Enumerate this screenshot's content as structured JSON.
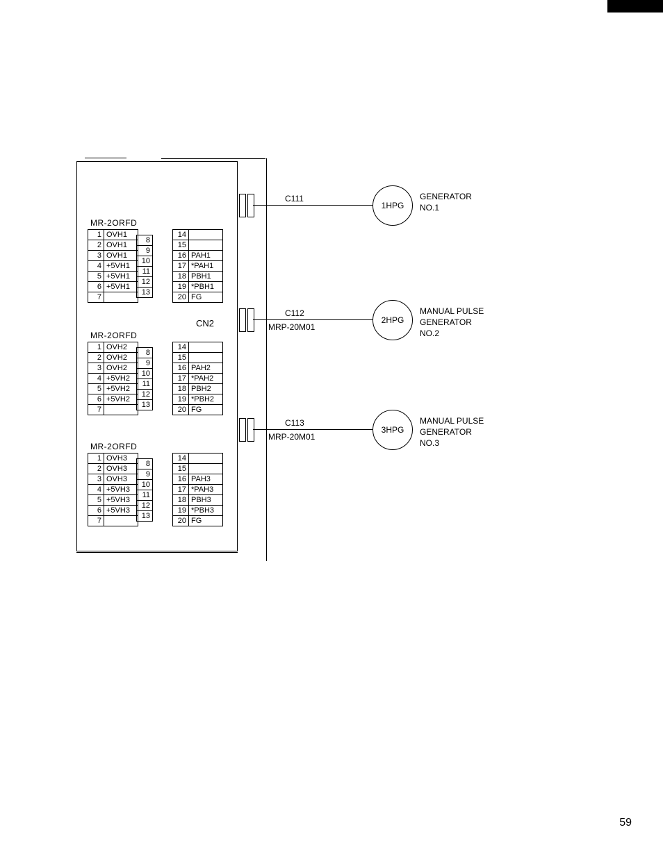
{
  "page_number": "59",
  "main_box_label": "CN2",
  "connectors": [
    {
      "title": "MR-2ORFD",
      "colA": [
        {
          "n": "1",
          "s": "OVH1"
        },
        {
          "n": "2",
          "s": "OVH1"
        },
        {
          "n": "3",
          "s": "OVH1"
        },
        {
          "n": "4",
          "s": "+5VH1"
        },
        {
          "n": "5",
          "s": "+5VH1"
        },
        {
          "n": "6",
          "s": "+5VH1"
        },
        {
          "n": "7",
          "s": ""
        }
      ],
      "colB": [
        {
          "n": "8"
        },
        {
          "n": "9"
        },
        {
          "n": "10"
        },
        {
          "n": "11"
        },
        {
          "n": "12"
        },
        {
          "n": "13"
        }
      ],
      "colC": [
        {
          "n": "14",
          "s": ""
        },
        {
          "n": "15",
          "s": ""
        },
        {
          "n": "16",
          "s": "PAH1"
        },
        {
          "n": "17",
          "s": "*PAH1"
        },
        {
          "n": "18",
          "s": "PBH1"
        },
        {
          "n": "19",
          "s": "*PBH1"
        },
        {
          "n": "20",
          "s": "FG"
        }
      ]
    },
    {
      "title": "MR-2ORFD",
      "colA": [
        {
          "n": "1",
          "s": "OVH2"
        },
        {
          "n": "2",
          "s": "OVH2"
        },
        {
          "n": "3",
          "s": "OVH2"
        },
        {
          "n": "4",
          "s": "+5VH2"
        },
        {
          "n": "5",
          "s": "+5VH2"
        },
        {
          "n": "6",
          "s": "+5VH2"
        },
        {
          "n": "7",
          "s": ""
        }
      ],
      "colB": [
        {
          "n": "8"
        },
        {
          "n": "9"
        },
        {
          "n": "10"
        },
        {
          "n": "11"
        },
        {
          "n": "12"
        },
        {
          "n": "13"
        }
      ],
      "colC": [
        {
          "n": "14",
          "s": ""
        },
        {
          "n": "15",
          "s": ""
        },
        {
          "n": "16",
          "s": "PAH2"
        },
        {
          "n": "17",
          "s": "*PAH2"
        },
        {
          "n": "18",
          "s": "PBH2"
        },
        {
          "n": "19",
          "s": "*PBH2"
        },
        {
          "n": "20",
          "s": "FG"
        }
      ]
    },
    {
      "title": "MR-2ORFD",
      "colA": [
        {
          "n": "1",
          "s": "OVH3"
        },
        {
          "n": "2",
          "s": "OVH3"
        },
        {
          "n": "3",
          "s": "OVH3"
        },
        {
          "n": "4",
          "s": "+5VH3"
        },
        {
          "n": "5",
          "s": "+5VH3"
        },
        {
          "n": "6",
          "s": "+5VH3"
        },
        {
          "n": "7",
          "s": ""
        }
      ],
      "colB": [
        {
          "n": "8"
        },
        {
          "n": "9"
        },
        {
          "n": "10"
        },
        {
          "n": "11"
        },
        {
          "n": "12"
        },
        {
          "n": "13"
        }
      ],
      "colC": [
        {
          "n": "14",
          "s": ""
        },
        {
          "n": "15",
          "s": ""
        },
        {
          "n": "16",
          "s": "PAH3"
        },
        {
          "n": "17",
          "s": "*PAH3"
        },
        {
          "n": "18",
          "s": "PBH3"
        },
        {
          "n": "19",
          "s": "*PBH3"
        },
        {
          "n": "20",
          "s": "FG"
        }
      ]
    }
  ],
  "cables": [
    {
      "c": "C111",
      "mrp": "",
      "hpg": "1HPG",
      "gen1": "GENERATOR",
      "gen2": "NO.1"
    },
    {
      "c": "C112",
      "mrp": "MRP-20M01",
      "hpg": "2HPG",
      "gen1": "MANUAL PULSE",
      "gen2": "GENERATOR",
      "gen3": "NO.2"
    },
    {
      "c": "C113",
      "mrp": "MRP-20M01",
      "hpg": "3HPG",
      "gen1": "MANUAL PULSE",
      "gen2": "GENERATOR",
      "gen3": "NO.3"
    }
  ]
}
